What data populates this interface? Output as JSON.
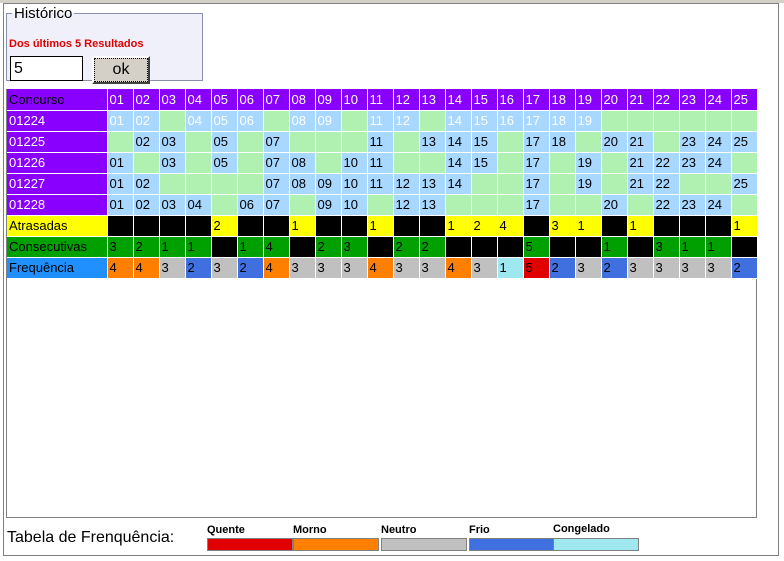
{
  "historico": {
    "title": "Histórico",
    "subtitle": "Dos últimos 5 Resultados",
    "input_value": "5",
    "button_label": "ok"
  },
  "table": {
    "corner_label": "Concurso",
    "columns": [
      "01",
      "02",
      "03",
      "04",
      "05",
      "06",
      "07",
      "08",
      "09",
      "10",
      "11",
      "12",
      "13",
      "14",
      "15",
      "16",
      "17",
      "18",
      "19",
      "20",
      "21",
      "22",
      "23",
      "24",
      "25"
    ],
    "draws": [
      {
        "label": "01224",
        "values": [
          "01",
          "02",
          "",
          "04",
          "05",
          "06",
          "",
          "08",
          "09",
          "",
          "11",
          "12",
          "",
          "14",
          "15",
          "16",
          "17",
          "18",
          "19",
          "",
          "",
          "",
          "",
          "",
          ""
        ]
      },
      {
        "label": "01225",
        "values": [
          "",
          "02",
          "03",
          "",
          "05",
          "",
          "07",
          "",
          "",
          "",
          "11",
          "",
          "13",
          "14",
          "15",
          "",
          "17",
          "18",
          "",
          "20",
          "21",
          "",
          "23",
          "24",
          "25"
        ]
      },
      {
        "label": "01226",
        "values": [
          "01",
          "",
          "03",
          "",
          "05",
          "",
          "07",
          "08",
          "",
          "10",
          "11",
          "",
          "",
          "14",
          "15",
          "",
          "17",
          "",
          "19",
          "",
          "21",
          "22",
          "23",
          "24",
          ""
        ]
      },
      {
        "label": "01227",
        "values": [
          "01",
          "02",
          "",
          "",
          "",
          "",
          "07",
          "08",
          "09",
          "10",
          "11",
          "12",
          "13",
          "14",
          "",
          "",
          "17",
          "",
          "19",
          "",
          "21",
          "22",
          "",
          "",
          "25"
        ]
      },
      {
        "label": "01228",
        "values": [
          "01",
          "02",
          "03",
          "04",
          "",
          "06",
          "07",
          "",
          "09",
          "10",
          "",
          "12",
          "13",
          "",
          "",
          "",
          "17",
          "",
          "",
          "20",
          "",
          "22",
          "23",
          "24",
          ""
        ]
      }
    ],
    "atrasadas": {
      "label": "Atrasadas",
      "values": [
        "",
        "",
        "",
        "",
        "2",
        "",
        "",
        "1",
        "",
        "",
        "1",
        "",
        "",
        "1",
        "2",
        "4",
        "",
        "3",
        "1",
        "",
        "1",
        "",
        "",
        "",
        "1"
      ]
    },
    "consecutivas": {
      "label": "Consecutivas",
      "values": [
        "3",
        "2",
        "1",
        "1",
        "",
        "1",
        "4",
        "",
        "2",
        "3",
        "",
        "2",
        "2",
        "",
        "",
        "",
        "5",
        "",
        "",
        "1",
        "",
        "3",
        "1",
        "1",
        ""
      ]
    },
    "frequencia": {
      "label": "Frequência",
      "values": [
        "4",
        "4",
        "3",
        "2",
        "3",
        "2",
        "4",
        "3",
        "3",
        "3",
        "4",
        "3",
        "3",
        "4",
        "3",
        "1",
        "5",
        "2",
        "3",
        "2",
        "3",
        "3",
        "3",
        "3",
        "2"
      ]
    }
  },
  "legend": {
    "title": "Tabela de Frenquência:",
    "items": [
      {
        "name": "Quente",
        "color": "#e00000"
      },
      {
        "name": "Morno",
        "color": "#ff8000"
      },
      {
        "name": "Neutro",
        "color": "#c0c0c0"
      },
      {
        "name": "Frio",
        "color": "#4070e0"
      },
      {
        "name": "Congelado",
        "color": "#a0e8f0"
      }
    ]
  },
  "colors": {
    "header": "#8a00ff",
    "drawn": "#a8d8ff",
    "not_drawn": "#b0f0b0",
    "atrasadas_bg": "#ffff00",
    "consecutivas_bg": "#00a000",
    "frequencia_label": "#2090ff",
    "black": "#000000"
  }
}
